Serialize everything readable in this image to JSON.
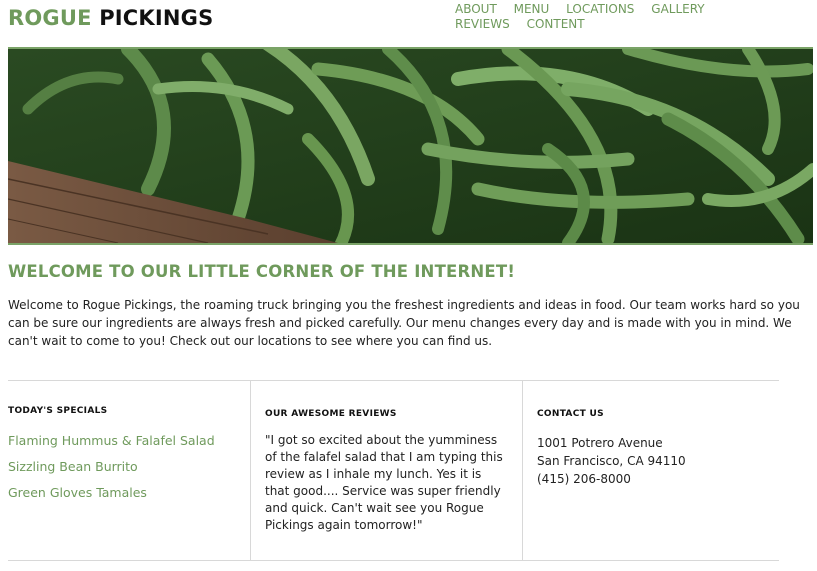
{
  "brand": {
    "first": "ROGUE",
    "second": "PICKINGS",
    "accent": "#6f9a5c"
  },
  "nav": [
    "ABOUT",
    "MENU",
    "LOCATIONS",
    "GALLERY",
    "REVIEWS",
    "CONTENT"
  ],
  "hero": {
    "image": "green beans photograph"
  },
  "welcome": {
    "title": "WELCOME TO OUR LITTLE CORNER OF THE INTERNET!",
    "text": "Welcome to Rogue Pickings, the roaming truck bringing you the freshest ingredients and ideas in food. Our team works hard so you can be sure our ingredients are always fresh and picked carefully. Our menu changes every day and is made with you in mind. We can't wait to come to you! Check out our locations to see where you can find us."
  },
  "specials": {
    "title": "TODAY'S SPECIALS",
    "items": [
      "Flaming Hummus & Falafel Salad",
      "Sizzling Bean Burrito",
      "Green Gloves Tamales"
    ]
  },
  "reviews": {
    "title": "OUR AWESOME REVIEWS",
    "text": "\"I got so excited about the yumminess of the falafel salad that I am typing this review as I inhale my lunch. Yes it is that good.... Service was super friendly and quick. Can't wait see you Rogue Pickings again tomorrow!\""
  },
  "contact": {
    "title": "CONTACT US",
    "address1": "1001 Potrero Avenue",
    "address2": "San Francisco, CA 94110",
    "phone": "(415) 206-8000"
  }
}
